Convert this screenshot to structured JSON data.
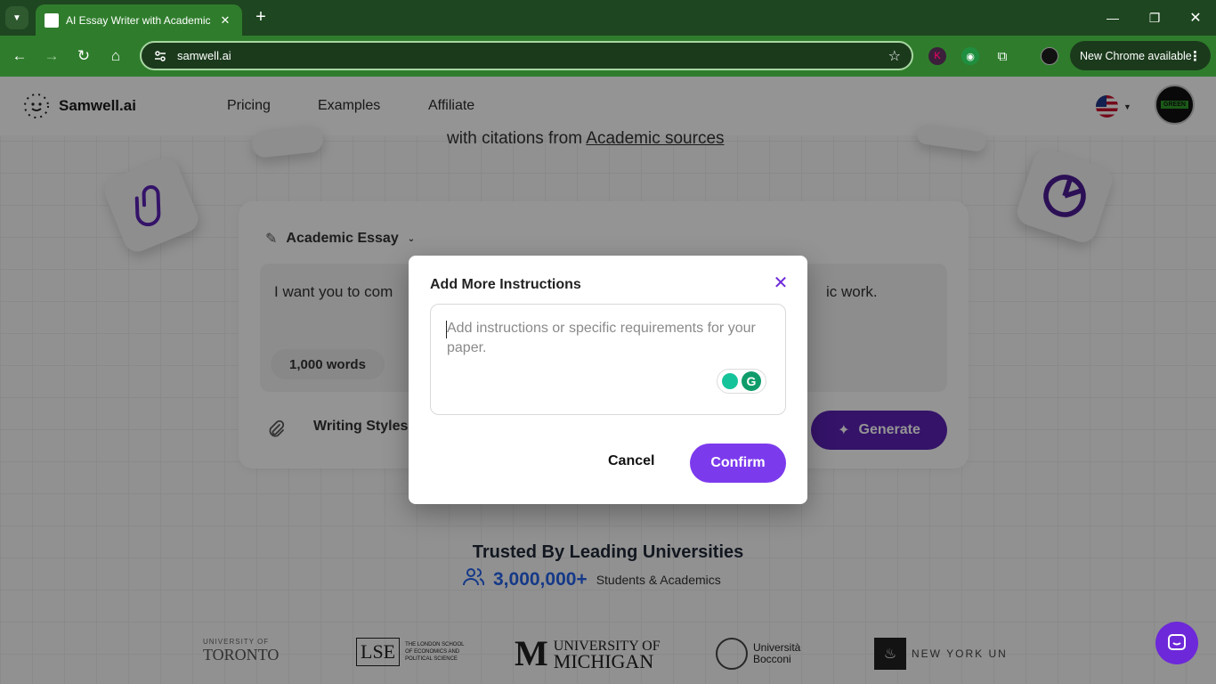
{
  "browser": {
    "tab_title": "AI Essay Writer with Academic C",
    "url": "samwell.ai",
    "update_label": "New Chrome available"
  },
  "site": {
    "brand": "Samwell.ai",
    "nav": [
      "Pricing",
      "Examples",
      "Affiliate"
    ],
    "subtitle_prefix": "with citations from ",
    "subtitle_link": "Academic sources",
    "avatar_text": "GREEN"
  },
  "editor": {
    "essay_type": "Academic Essay",
    "prompt_start": "I want you to com",
    "prompt_end": "ic work.",
    "word_count": "1,000 words",
    "writing_styles": "Writing Styles",
    "generate_label": "Generate"
  },
  "trust": {
    "heading": "Trusted By Leading Universities",
    "count": "3,000,000+",
    "count_label": "Students & Academics"
  },
  "universities": [
    {
      "name": "UNIVERSITY OF",
      "sub": "TORONTO"
    },
    {
      "name": "LSE",
      "sub": "THE LONDON SCHOOL OF ECONOMICS AND POLITICAL SCIENCE"
    },
    {
      "name": "UNIVERSITY OF",
      "sub": "MICHIGAN"
    },
    {
      "name": "Università",
      "sub": "Bocconi"
    },
    {
      "name": "NEW YORK UN",
      "sub": ""
    }
  ],
  "modal": {
    "title": "Add More Instructions",
    "placeholder": "Add instructions or specific requirements for your paper.",
    "value": "",
    "cancel_label": "Cancel",
    "confirm_label": "Confirm"
  },
  "colors": {
    "accent": "#7c3aed",
    "accent_dark": "#5b21b6",
    "chrome_bar": "#2f7d2c",
    "stat_blue": "#2563eb"
  }
}
